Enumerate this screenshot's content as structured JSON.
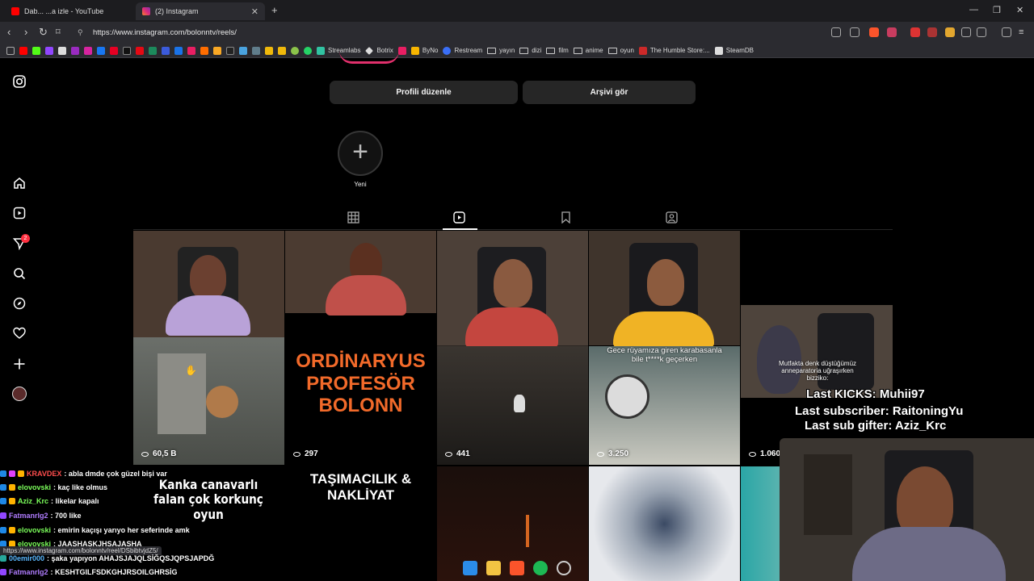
{
  "browser": {
    "tabs": [
      {
        "label": "Dab... ...a izle - YouTube"
      },
      {
        "label": "(2) Instagram"
      }
    ],
    "url": "https://www.instagram.com/bolonntv/reels/",
    "bookmarks": [
      "Streamlabs",
      "Botrix",
      "ByNo",
      "Restream",
      "yayın",
      "dizi",
      "film",
      "anime",
      "oyun",
      "The Humble Store:...",
      "SteamDB"
    ]
  },
  "profile": {
    "edit_button": "Profili düzenle",
    "archive_button": "Arşivi gör",
    "new_highlight": "Yeni"
  },
  "sidebar": {
    "notif_count": "2"
  },
  "reels": [
    {
      "views": "60,5 B"
    },
    {
      "views": "297",
      "text_lines": [
        "ORDİNARYUS",
        "PROFESÖR",
        "BOLONN"
      ]
    },
    {
      "views": "441"
    },
    {
      "views": "3.250",
      "caption": "Gece rüyamıza giren karabasanla bile t****k geçerken"
    },
    {
      "views": "1.060",
      "caption": "Mutfakta denk düştüğümüz anneparatoria uğraşırken bizziko:"
    },
    {
      "caption": "Kanka canavarlı falan çok korkunç oyun"
    },
    {
      "caption": "TAŞIMACILIK & NAKLİYAT"
    }
  ],
  "stream_overlay": {
    "last_kicks": "Last KICKS: Muhii97",
    "last_subscriber": "Last subscriber: RaitoningYu",
    "last_gifter": "Last sub gifter: Aziz_Krc"
  },
  "chat": [
    {
      "user": "KRAVDEX",
      "color": "#ff4d4d",
      "text": ": abla dmde çok güzel bişi var"
    },
    {
      "user": "elovovski",
      "color": "#7cff5b",
      "text": ": kaç like olmus"
    },
    {
      "user": "Aziz_Krc",
      "color": "#7cff5b",
      "text": ": likelar kapalı"
    },
    {
      "user": "Fatmanrlg2",
      "color": "#b07cff",
      "text": ": 700 like"
    },
    {
      "user": "elovovski",
      "color": "#7cff5b",
      "text": ": emirin kaçışı yarıyo her seferinde amk"
    },
    {
      "user": "elovovski",
      "color": "#7cff5b",
      "text": ": JAASHASKJHSAJASHA"
    },
    {
      "user": "00emir000",
      "color": "#5bb8ff",
      "text": ": şaka yapıyon AHAJSJAJQLSİĞQSJQPSJAPDĞ"
    },
    {
      "user": "Fatmanrlg2",
      "color": "#b07cff",
      "text": ": KESHTGILFSDKGHJRSOILGHRSİG"
    }
  ],
  "status_url": "https://www.instagram.com/bolonntv/reel/DSbibtvjdZ5/",
  "colors": {
    "bg": "#000000",
    "button_bg": "#262626",
    "accent": "#ff3040",
    "orange_text": "#f26a2a"
  }
}
